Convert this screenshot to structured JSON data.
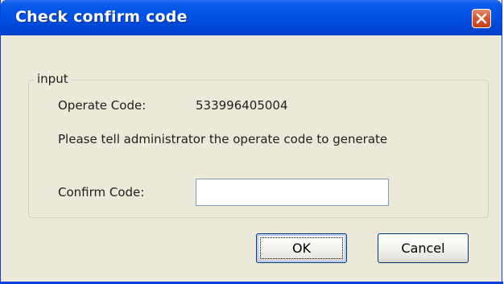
{
  "window": {
    "title": "Check confirm code"
  },
  "titlebar": {
    "close_icon": "close-icon",
    "close_color": "#d9582f"
  },
  "group": {
    "legend": "input"
  },
  "operate_code": {
    "label": "Operate Code:",
    "value": "533996405004"
  },
  "instruction": "Please tell administrator the operate code to generate",
  "confirm_code": {
    "label": "Confirm Code:",
    "value": "",
    "placeholder": ""
  },
  "buttons": {
    "ok_label": "OK",
    "cancel_label": "Cancel"
  },
  "colors": {
    "titlebar": "#0052e4",
    "dialog_background": "#ece9d8",
    "button_border": "#003c74"
  }
}
